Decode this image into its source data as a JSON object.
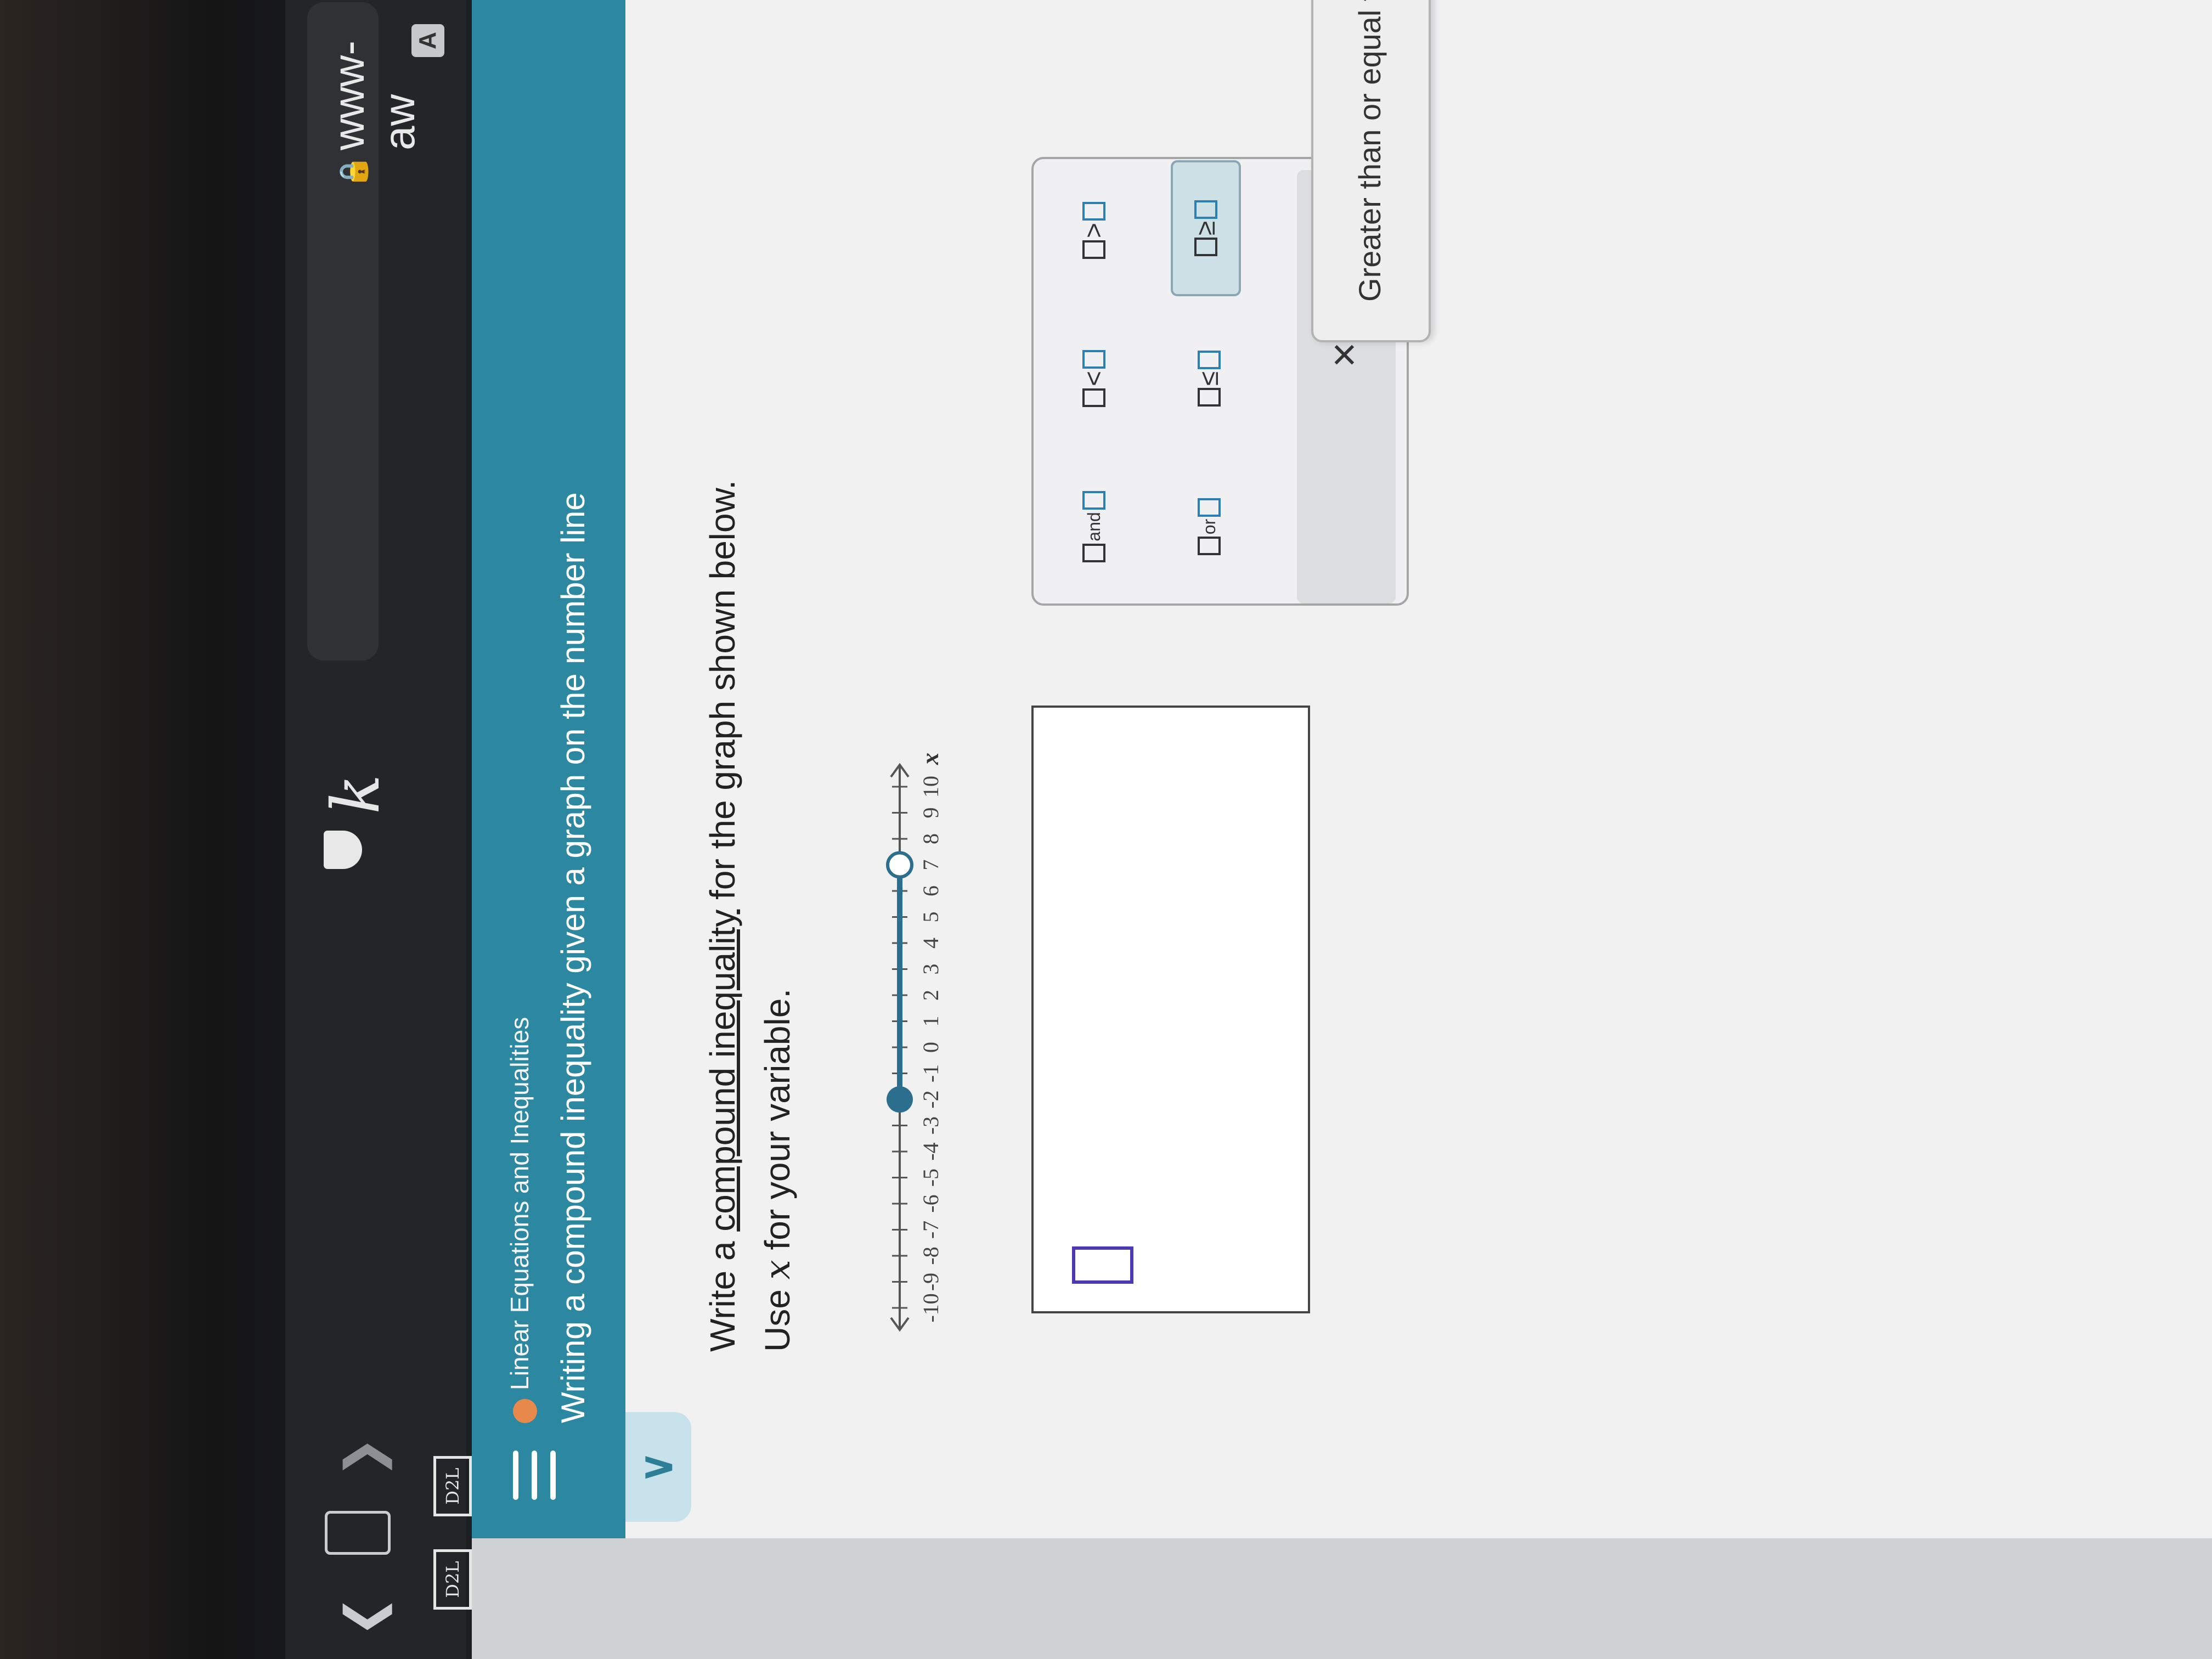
{
  "browser": {
    "url_text": "www-aw",
    "bookmarks": [
      "D2L",
      "D2L"
    ],
    "profile_initial": "A",
    "profile_partial": "Al"
  },
  "header": {
    "topic": "Linear Equations and Inequalities",
    "lesson": "Writing a compound inequality given a graph on the number line",
    "topic_status_color": "#e8894c"
  },
  "question": {
    "line1_before": "Write a ",
    "line1_link": "compound inequality",
    "line1_after": " for the graph shown below.",
    "line2_before": "Use ",
    "line2_var": "x",
    "line2_after": " for your variable."
  },
  "number_line": {
    "min": -10,
    "max": 10,
    "tick_labels": [
      "-10",
      "-9",
      "-8",
      "-7",
      "-6",
      "-5",
      "-4",
      "-3",
      "-2",
      "-1",
      "0",
      "1",
      "2",
      "3",
      "4",
      "5",
      "6",
      "7",
      "8",
      "9",
      "10"
    ],
    "axis_label": "x",
    "left_endpoint": {
      "value": -2,
      "type": "closed"
    },
    "right_endpoint": {
      "value": 7,
      "type": "open"
    },
    "shade_color": "#2b6e8e"
  },
  "palette": {
    "keys": [
      {
        "name": "and-key",
        "label": "and"
      },
      {
        "name": "less-than-key",
        "label": "<"
      },
      {
        "name": "greater-than-key",
        "label": ">"
      },
      {
        "name": "or-key",
        "label": "or"
      },
      {
        "name": "less-equal-key",
        "label": "≤"
      },
      {
        "name": "greater-equal-key",
        "label": "≥"
      }
    ],
    "clear_label": "×",
    "tooltip": "Greater than or equal to"
  },
  "answer_box": {
    "value": ""
  }
}
